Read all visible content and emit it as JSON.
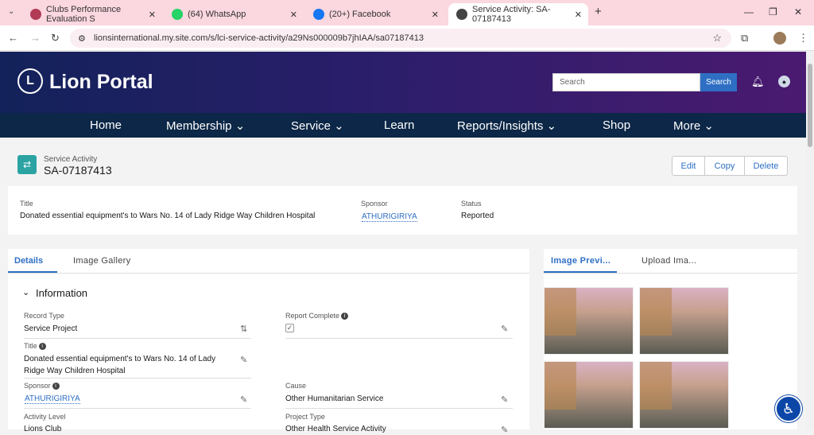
{
  "browser": {
    "tabs": [
      {
        "title": "Clubs Performance Evaluation S",
        "color": "#b13a55"
      },
      {
        "title": "(64) WhatsApp",
        "color": "#25d366"
      },
      {
        "title": "(20+) Facebook",
        "color": "#1877f2"
      },
      {
        "title": "Service Activity: SA-07187413",
        "color": "#444444"
      }
    ],
    "url": "lionsinternational.my.site.com/s/lci-service-activity/a29Ns000009b7jhIAA/sa07187413"
  },
  "portal": {
    "brand": "Lion Portal",
    "logo_text": "L",
    "search_placeholder": "Search",
    "search_button": "Search",
    "nav": [
      "Home",
      "Membership ⌄",
      "Service ⌄",
      "Learn",
      "Reports/Insights ⌄",
      "Shop",
      "More ⌄"
    ]
  },
  "record": {
    "object_label": "Service Activity",
    "name": "SA-07187413",
    "actions": [
      "Edit",
      "Copy",
      "Delete"
    ],
    "summary": {
      "title_label": "Title",
      "title_value": "Donated essential equipment's to Wars No. 14 of Lady Ridge Way Children Hospital",
      "sponsor_label": "Sponsor",
      "sponsor_value": "ATHURIGIRIYA",
      "status_label": "Status",
      "status_value": "Reported"
    }
  },
  "details": {
    "tabs": [
      "Details",
      "Image Gallery"
    ],
    "section": "Information",
    "fields": {
      "record_type_label": "Record Type",
      "record_type_value": "Service Project",
      "report_complete_label": "Report Complete",
      "title_label": "Title",
      "title_value_1": "Donated essential equipment's to Wars No. 14 of Lady",
      "title_value_2": "Ridge Way Children Hospital",
      "sponsor_label": "Sponsor",
      "sponsor_value": "ATHURIGIRIYA",
      "cause_label": "Cause",
      "cause_value": "Other Humanitarian Service",
      "activity_level_label": "Activity Level",
      "activity_level_value": "Lions Club",
      "project_type_label": "Project Type",
      "project_type_value": "Other Health Service Activity"
    }
  },
  "images": {
    "tabs": [
      "Image Previ...",
      "Upload Ima..."
    ],
    "count": 4
  },
  "colors": {
    "banner": "#13225a",
    "nav": "#0c2747",
    "link": "#2e6fc4",
    "accent": "#2ba3a3"
  }
}
